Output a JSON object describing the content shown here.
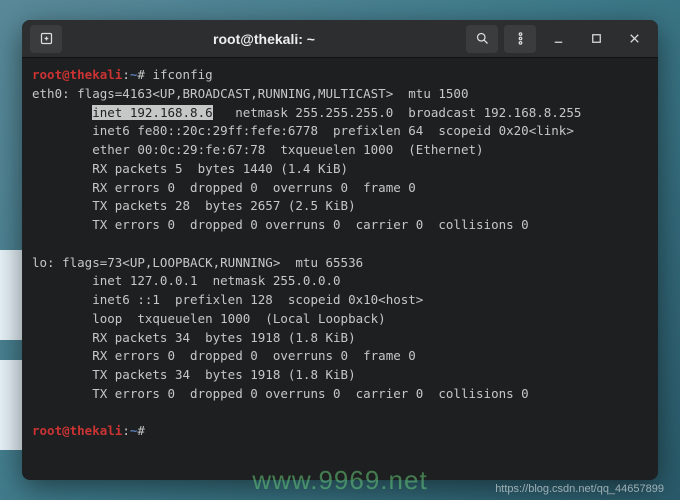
{
  "titlebar": {
    "title": "root@thekali: ~"
  },
  "prompt": {
    "user": "root@thekali",
    "sep": ":",
    "path": "~",
    "symbol": "#"
  },
  "command1": "ifconfig",
  "output": {
    "eth0_header": "eth0: flags=4163<UP,BROADCAST,RUNNING,MULTICAST>  mtu 1500",
    "eth0_inet_hl": "inet 192.168.8.6",
    "eth0_inet_rest": "   netmask 255.255.255.0  broadcast 192.168.8.255",
    "eth0_inet6": "        inet6 fe80::20c:29ff:fefe:6778  prefixlen 64  scopeid 0x20<link>",
    "eth0_ether": "        ether 00:0c:29:fe:67:78  txqueuelen 1000  (Ethernet)",
    "eth0_rx_p": "        RX packets 5  bytes 1440 (1.4 KiB)",
    "eth0_rx_e": "        RX errors 0  dropped 0  overruns 0  frame 0",
    "eth0_tx_p": "        TX packets 28  bytes 2657 (2.5 KiB)",
    "eth0_tx_e": "        TX errors 0  dropped 0 overruns 0  carrier 0  collisions 0",
    "blank": "",
    "lo_header": "lo: flags=73<UP,LOOPBACK,RUNNING>  mtu 65536",
    "lo_inet": "        inet 127.0.0.1  netmask 255.0.0.0",
    "lo_inet6": "        inet6 ::1  prefixlen 128  scopeid 0x10<host>",
    "lo_loop": "        loop  txqueuelen 1000  (Local Loopback)",
    "lo_rx_p": "        RX packets 34  bytes 1918 (1.8 KiB)",
    "lo_rx_e": "        RX errors 0  dropped 0  overruns 0  frame 0",
    "lo_tx_p": "        TX packets 34  bytes 1918 (1.8 KiB)",
    "lo_tx_e": "        TX errors 0  dropped 0 overruns 0  carrier 0  collisions 0"
  },
  "watermark1": "www.9969.net",
  "watermark2": "https://blog.csdn.net/qq_44657899"
}
